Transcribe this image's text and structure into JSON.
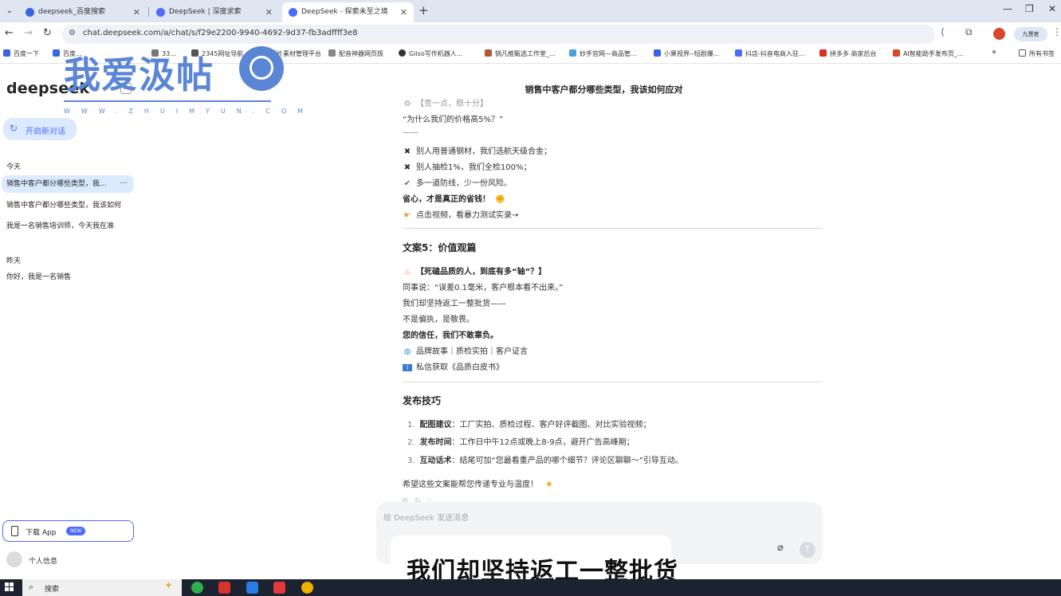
{
  "browser": {
    "tabs": [
      {
        "title": "deepseek_百度搜索",
        "active": false
      },
      {
        "title": "DeepSeek | 深度求索",
        "active": false
      },
      {
        "title": "DeepSeek - 探索未至之境",
        "active": true
      }
    ],
    "url": "chat.deepseek.com/a/chat/s/f29e2200-9940-4692-9d37-fb3adffff3e8",
    "profile_label": "九慧官",
    "bookmarks": [
      "百度一下",
      "百度...",
      "33...",
      "2345网址导航",
      "图片素材管理平台",
      "配音神器网页版",
      "Giiso写作机器人...",
      "锅凡推甄选工作室_...",
      "妙手官网—商品管...",
      "小果视界--短剧爆...",
      "抖店-抖音电商入驻...",
      "拼多多 商家后台",
      "AI智能助手发布页_..."
    ],
    "bookmarks_more": "»",
    "bookmarks_folder": "所有书签"
  },
  "watermark": {
    "title": "我爱汲帖",
    "url": "WWW.ZHUIMYUN.COM"
  },
  "sidebar": {
    "logo": "deepseek",
    "new_chat": "开启新对话",
    "groups": [
      {
        "label": "今天",
        "items": [
          "销售中客户都分哪些类型，我...",
          "销售中客户都分哪些类型，我该如何",
          "我是一名销售培训师，今天我在准"
        ]
      },
      {
        "label": "昨天",
        "items": [
          "你好，我是一名销售"
        ]
      }
    ],
    "more": "···",
    "download_app": "下载 App",
    "new_badge": "NEW",
    "profile": "个人信息"
  },
  "chat": {
    "title": "销售中客户都分哪些类型，我该如何应对",
    "block1": {
      "cut_heading": "【贵一点，稳十分】",
      "quote": "“为什么我们的价格高5%？”",
      "dash": "——",
      "items": [
        {
          "icon": "✖",
          "text": "别人用普通钢材，我们选航天级合金；"
        },
        {
          "icon": "✖",
          "text": "别人抽检1%，我们全检100%；"
        },
        {
          "icon": "✔",
          "text": "多一道防线，少一份风险。"
        }
      ],
      "bold_line": "省心，才是真正的省钱！",
      "cta": "点击视频，看暴力测试实录→"
    },
    "block2": {
      "heading": "文案5：价值观篇",
      "hook": "【死磕品质的人，到底有多“轴”？】",
      "lines": [
        "同事说：“误差0.1毫米，客户根本看不出来。”",
        "我们却坚持返工一整批货——",
        "不是偏执，是敬畏。"
      ],
      "bold_line": "您的信任，我们不敢辜负。",
      "links": "品牌故事｜质检实拍｜客户证言",
      "private": "私信获取《品质白皮书》"
    },
    "tips": {
      "heading": "发布技巧",
      "items": [
        {
          "label": "配图建议",
          "text": "：工厂实拍、质检过程、客户好评截图、对比实验视频；"
        },
        {
          "label": "发布时间",
          "text": "：工作日中午12点或晚上8-9点，避开广告高峰期；"
        },
        {
          "label": "互动话术",
          "text": "：结尾可加“您最看重产品的哪个细节？评论区聊聊～”引导互动。"
        }
      ]
    },
    "closing": "希望这些文案能帮您传递专业与温度！",
    "composer_placeholder": "给 DeepSeek 发送消息",
    "subtitle": "我们却坚持返工一整批货"
  },
  "taskbar": {
    "search": "搜索"
  },
  "colors": {
    "accent": "#4d6bfe",
    "watermark": "#5b86d6",
    "sidebar_selected": "#dbeafe"
  }
}
